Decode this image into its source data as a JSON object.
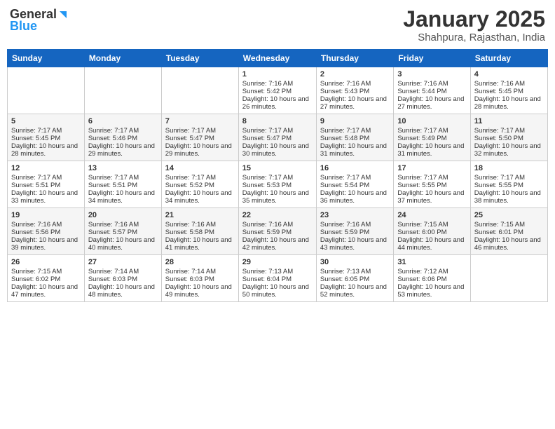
{
  "header": {
    "logo_general": "General",
    "logo_blue": "Blue",
    "month_title": "January 2025",
    "subtitle": "Shahpura, Rajasthan, India"
  },
  "weekdays": [
    "Sunday",
    "Monday",
    "Tuesday",
    "Wednesday",
    "Thursday",
    "Friday",
    "Saturday"
  ],
  "weeks": [
    [
      {
        "day": "",
        "sunrise": "",
        "sunset": "",
        "daylight": ""
      },
      {
        "day": "",
        "sunrise": "",
        "sunset": "",
        "daylight": ""
      },
      {
        "day": "",
        "sunrise": "",
        "sunset": "",
        "daylight": ""
      },
      {
        "day": "1",
        "sunrise": "Sunrise: 7:16 AM",
        "sunset": "Sunset: 5:42 PM",
        "daylight": "Daylight: 10 hours and 26 minutes."
      },
      {
        "day": "2",
        "sunrise": "Sunrise: 7:16 AM",
        "sunset": "Sunset: 5:43 PM",
        "daylight": "Daylight: 10 hours and 27 minutes."
      },
      {
        "day": "3",
        "sunrise": "Sunrise: 7:16 AM",
        "sunset": "Sunset: 5:44 PM",
        "daylight": "Daylight: 10 hours and 27 minutes."
      },
      {
        "day": "4",
        "sunrise": "Sunrise: 7:16 AM",
        "sunset": "Sunset: 5:45 PM",
        "daylight": "Daylight: 10 hours and 28 minutes."
      }
    ],
    [
      {
        "day": "5",
        "sunrise": "Sunrise: 7:17 AM",
        "sunset": "Sunset: 5:45 PM",
        "daylight": "Daylight: 10 hours and 28 minutes."
      },
      {
        "day": "6",
        "sunrise": "Sunrise: 7:17 AM",
        "sunset": "Sunset: 5:46 PM",
        "daylight": "Daylight: 10 hours and 29 minutes."
      },
      {
        "day": "7",
        "sunrise": "Sunrise: 7:17 AM",
        "sunset": "Sunset: 5:47 PM",
        "daylight": "Daylight: 10 hours and 29 minutes."
      },
      {
        "day": "8",
        "sunrise": "Sunrise: 7:17 AM",
        "sunset": "Sunset: 5:47 PM",
        "daylight": "Daylight: 10 hours and 30 minutes."
      },
      {
        "day": "9",
        "sunrise": "Sunrise: 7:17 AM",
        "sunset": "Sunset: 5:48 PM",
        "daylight": "Daylight: 10 hours and 31 minutes."
      },
      {
        "day": "10",
        "sunrise": "Sunrise: 7:17 AM",
        "sunset": "Sunset: 5:49 PM",
        "daylight": "Daylight: 10 hours and 31 minutes."
      },
      {
        "day": "11",
        "sunrise": "Sunrise: 7:17 AM",
        "sunset": "Sunset: 5:50 PM",
        "daylight": "Daylight: 10 hours and 32 minutes."
      }
    ],
    [
      {
        "day": "12",
        "sunrise": "Sunrise: 7:17 AM",
        "sunset": "Sunset: 5:51 PM",
        "daylight": "Daylight: 10 hours and 33 minutes."
      },
      {
        "day": "13",
        "sunrise": "Sunrise: 7:17 AM",
        "sunset": "Sunset: 5:51 PM",
        "daylight": "Daylight: 10 hours and 34 minutes."
      },
      {
        "day": "14",
        "sunrise": "Sunrise: 7:17 AM",
        "sunset": "Sunset: 5:52 PM",
        "daylight": "Daylight: 10 hours and 34 minutes."
      },
      {
        "day": "15",
        "sunrise": "Sunrise: 7:17 AM",
        "sunset": "Sunset: 5:53 PM",
        "daylight": "Daylight: 10 hours and 35 minutes."
      },
      {
        "day": "16",
        "sunrise": "Sunrise: 7:17 AM",
        "sunset": "Sunset: 5:54 PM",
        "daylight": "Daylight: 10 hours and 36 minutes."
      },
      {
        "day": "17",
        "sunrise": "Sunrise: 7:17 AM",
        "sunset": "Sunset: 5:55 PM",
        "daylight": "Daylight: 10 hours and 37 minutes."
      },
      {
        "day": "18",
        "sunrise": "Sunrise: 7:17 AM",
        "sunset": "Sunset: 5:55 PM",
        "daylight": "Daylight: 10 hours and 38 minutes."
      }
    ],
    [
      {
        "day": "19",
        "sunrise": "Sunrise: 7:16 AM",
        "sunset": "Sunset: 5:56 PM",
        "daylight": "Daylight: 10 hours and 39 minutes."
      },
      {
        "day": "20",
        "sunrise": "Sunrise: 7:16 AM",
        "sunset": "Sunset: 5:57 PM",
        "daylight": "Daylight: 10 hours and 40 minutes."
      },
      {
        "day": "21",
        "sunrise": "Sunrise: 7:16 AM",
        "sunset": "Sunset: 5:58 PM",
        "daylight": "Daylight: 10 hours and 41 minutes."
      },
      {
        "day": "22",
        "sunrise": "Sunrise: 7:16 AM",
        "sunset": "Sunset: 5:59 PM",
        "daylight": "Daylight: 10 hours and 42 minutes."
      },
      {
        "day": "23",
        "sunrise": "Sunrise: 7:16 AM",
        "sunset": "Sunset: 5:59 PM",
        "daylight": "Daylight: 10 hours and 43 minutes."
      },
      {
        "day": "24",
        "sunrise": "Sunrise: 7:15 AM",
        "sunset": "Sunset: 6:00 PM",
        "daylight": "Daylight: 10 hours and 44 minutes."
      },
      {
        "day": "25",
        "sunrise": "Sunrise: 7:15 AM",
        "sunset": "Sunset: 6:01 PM",
        "daylight": "Daylight: 10 hours and 46 minutes."
      }
    ],
    [
      {
        "day": "26",
        "sunrise": "Sunrise: 7:15 AM",
        "sunset": "Sunset: 6:02 PM",
        "daylight": "Daylight: 10 hours and 47 minutes."
      },
      {
        "day": "27",
        "sunrise": "Sunrise: 7:14 AM",
        "sunset": "Sunset: 6:03 PM",
        "daylight": "Daylight: 10 hours and 48 minutes."
      },
      {
        "day": "28",
        "sunrise": "Sunrise: 7:14 AM",
        "sunset": "Sunset: 6:03 PM",
        "daylight": "Daylight: 10 hours and 49 minutes."
      },
      {
        "day": "29",
        "sunrise": "Sunrise: 7:13 AM",
        "sunset": "Sunset: 6:04 PM",
        "daylight": "Daylight: 10 hours and 50 minutes."
      },
      {
        "day": "30",
        "sunrise": "Sunrise: 7:13 AM",
        "sunset": "Sunset: 6:05 PM",
        "daylight": "Daylight: 10 hours and 52 minutes."
      },
      {
        "day": "31",
        "sunrise": "Sunrise: 7:12 AM",
        "sunset": "Sunset: 6:06 PM",
        "daylight": "Daylight: 10 hours and 53 minutes."
      },
      {
        "day": "",
        "sunrise": "",
        "sunset": "",
        "daylight": ""
      }
    ]
  ]
}
